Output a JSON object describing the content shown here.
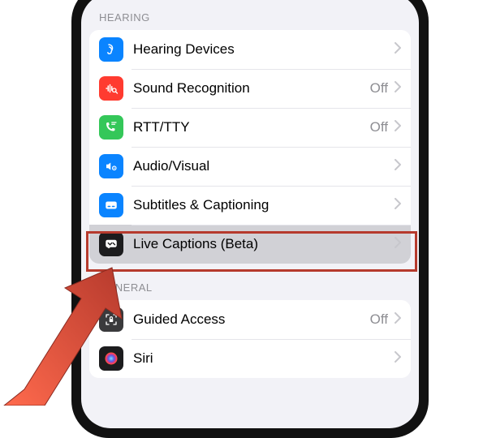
{
  "sections": [
    {
      "header": "HEARING",
      "items": [
        {
          "id": "hearing-devices",
          "label": "Hearing Devices",
          "value": null,
          "icon": "ear-icon",
          "icon_bg": "#0a84ff",
          "icon_fg": "#ffffff"
        },
        {
          "id": "sound-recognition",
          "label": "Sound Recognition",
          "value": "Off",
          "icon": "sound-search-icon",
          "icon_bg": "#ff3b30",
          "icon_fg": "#ffffff"
        },
        {
          "id": "rtt-tty",
          "label": "RTT/TTY",
          "value": "Off",
          "icon": "phone-text-icon",
          "icon_bg": "#34c759",
          "icon_fg": "#ffffff"
        },
        {
          "id": "audio-visual",
          "label": "Audio/Visual",
          "value": null,
          "icon": "speaker-eye-icon",
          "icon_bg": "#0a84ff",
          "icon_fg": "#ffffff"
        },
        {
          "id": "subtitles-captioning",
          "label": "Subtitles & Captioning",
          "value": null,
          "icon": "captions-icon",
          "icon_bg": "#0a84ff",
          "icon_fg": "#ffffff"
        },
        {
          "id": "live-captions",
          "label": "Live Captions (Beta)",
          "value": null,
          "icon": "live-captions-icon",
          "icon_bg": "#1c1c1e",
          "icon_fg": "#ffffff",
          "selected": true,
          "highlighted": true
        }
      ]
    },
    {
      "header": "GENERAL",
      "items": [
        {
          "id": "guided-access",
          "label": "Guided Access",
          "value": "Off",
          "icon": "lock-frame-icon",
          "icon_bg": "#3a3a3c",
          "icon_fg": "#ffffff"
        },
        {
          "id": "siri",
          "label": "Siri",
          "value": null,
          "icon": "siri-icon",
          "icon_bg": "#1c1c1e",
          "icon_fg": "#ffffff"
        }
      ]
    }
  ],
  "highlight_color": "#b63a2d",
  "arrow_color_start": "#ff6a4d",
  "arrow_color_end": "#b63a2d"
}
